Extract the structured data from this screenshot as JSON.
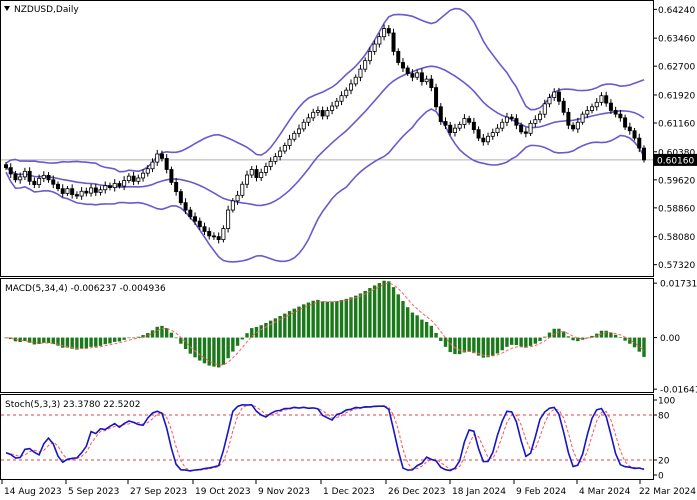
{
  "window": {
    "title": "NZDUSD,Daily",
    "menu_icon": "triangle-down-icon"
  },
  "colors": {
    "bull": "#000000",
    "bear": "#000000",
    "bands": "#6a5acd",
    "macd_hist": "#1a7a1a",
    "macd_signal": "#ff6060",
    "stoch_main": "#1515c8",
    "stoch_signal": "#ff5050",
    "level_line": "#e00000",
    "price_line": "#b0b0b0",
    "grid": "#000000"
  },
  "chart_data": [
    {
      "type": "candlestick",
      "title": "NZDUSD,Daily",
      "ylim": [
        0.5704,
        0.6444
      ],
      "price_ticks": [
        "0.64240",
        "0.63460",
        "0.62700",
        "0.61920",
        "0.61160",
        "0.60380",
        "0.59620",
        "0.58860",
        "0.58080",
        "0.57320"
      ],
      "current_price": "0.60160",
      "x_ticks": [
        "14 Aug 2023",
        "5 Sep 2023",
        "27 Sep 2023",
        "19 Oct 2023",
        "9 Nov 2023",
        "1 Dec 2023",
        "26 Dec 2023",
        "18 Jan 2024",
        "9 Feb 2024",
        "4 Mar 2024",
        "22 Mar 2024"
      ],
      "close": [
        0.5995,
        0.5978,
        0.5962,
        0.597,
        0.5985,
        0.5958,
        0.5949,
        0.5966,
        0.5974,
        0.5962,
        0.595,
        0.5938,
        0.5925,
        0.5938,
        0.5922,
        0.5918,
        0.5931,
        0.5926,
        0.594,
        0.5928,
        0.5935,
        0.5946,
        0.5941,
        0.5952,
        0.5945,
        0.596,
        0.5972,
        0.5958,
        0.5967,
        0.598,
        0.5992,
        0.601,
        0.6032,
        0.602,
        0.599,
        0.5955,
        0.593,
        0.59,
        0.588,
        0.5862,
        0.585,
        0.5835,
        0.5822,
        0.581,
        0.5808,
        0.58,
        0.583,
        0.588,
        0.5905,
        0.592,
        0.595,
        0.5975,
        0.599,
        0.5968,
        0.5982,
        0.5998,
        0.6012,
        0.6025,
        0.604,
        0.6055,
        0.6072,
        0.6088,
        0.61,
        0.6118,
        0.613,
        0.6145,
        0.615,
        0.6135,
        0.615,
        0.6162,
        0.6175,
        0.619,
        0.6205,
        0.6222,
        0.624,
        0.6262,
        0.6285,
        0.631,
        0.633,
        0.635,
        0.6372,
        0.636,
        0.631,
        0.628,
        0.6265,
        0.625,
        0.624,
        0.6252,
        0.6228,
        0.6235,
        0.6212,
        0.616,
        0.612,
        0.611,
        0.609,
        0.6102,
        0.6112,
        0.6128,
        0.6118,
        0.6098,
        0.6075,
        0.6065,
        0.608,
        0.609,
        0.6102,
        0.6118,
        0.6132,
        0.6128,
        0.611,
        0.6092,
        0.6088,
        0.6115,
        0.6125,
        0.614,
        0.6168,
        0.6185,
        0.62,
        0.6175,
        0.6145,
        0.611,
        0.61,
        0.6118,
        0.614,
        0.615,
        0.616,
        0.6172,
        0.619,
        0.617,
        0.615,
        0.614,
        0.613,
        0.6105,
        0.6095,
        0.6075,
        0.6048,
        0.6016
      ]
    },
    {
      "type": "histogram",
      "title": "MACD(5,34,4) -0.006237 -0.004936",
      "ylim": [
        -0.017,
        0.018
      ],
      "tick_labels": [
        "0.017319",
        "0.00",
        "-0.016414"
      ],
      "series": [
        {
          "name": "MACD(5,34,4)"
        }
      ]
    },
    {
      "type": "line",
      "title": "Stoch(5,3,3) 23.3780 22.5202",
      "ylim": [
        0,
        100
      ],
      "tick_labels": [
        "100",
        "80",
        "20",
        "0"
      ],
      "levels": [
        80,
        20
      ]
    }
  ]
}
